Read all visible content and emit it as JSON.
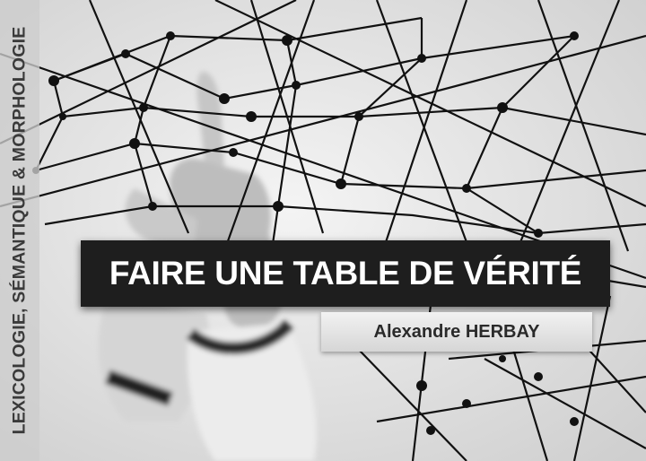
{
  "side_label": "LEXICOLOGIE, SÉMANTIQUE & MORPHOLOGIE",
  "title": "FAIRE UNE TABLE DE VÉRITÉ",
  "author": "Alexandre HERBAY",
  "colors": {
    "title_bg": "#1e1e1e",
    "title_fg": "#ffffff",
    "author_bg": "#e6e6e6",
    "author_fg": "#2a2a2a",
    "side_band": "#cdcdcd"
  }
}
